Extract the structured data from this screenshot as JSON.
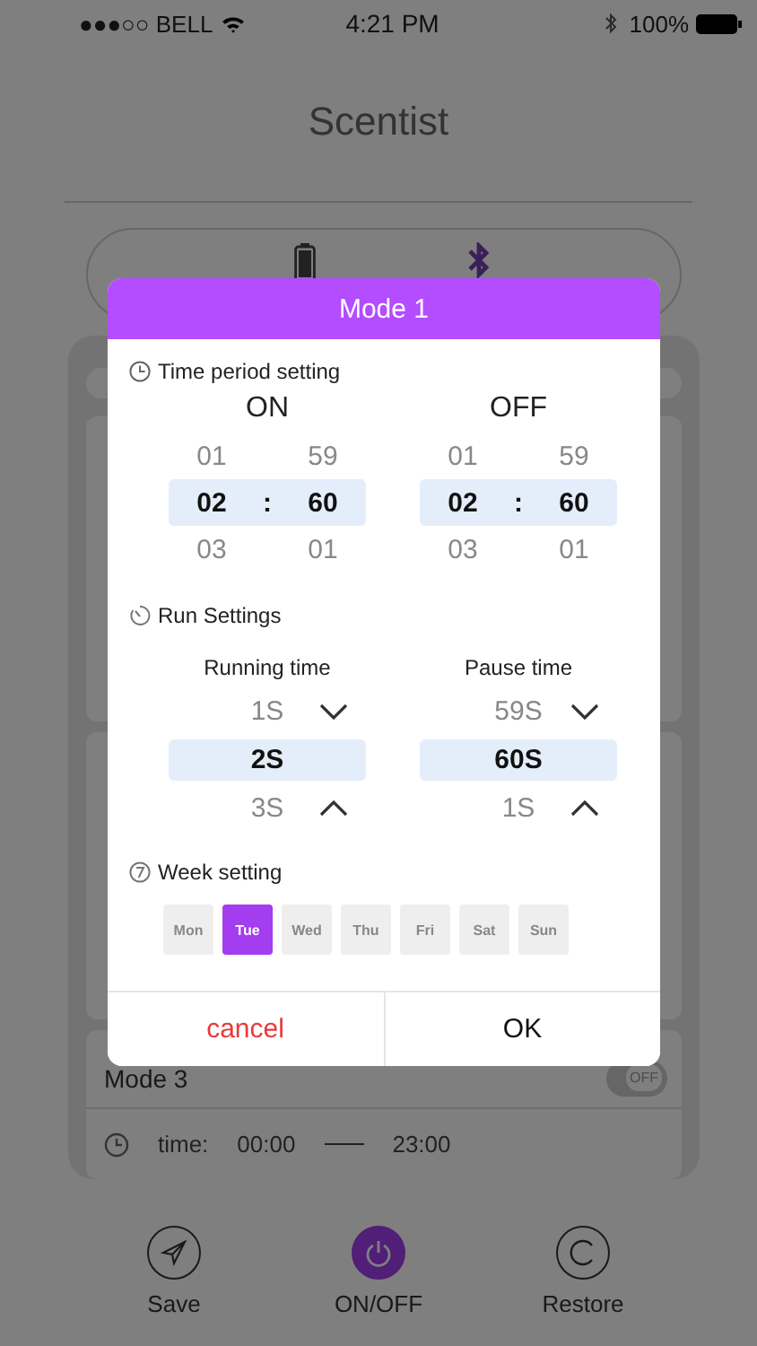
{
  "status_bar": {
    "carrier": "●●●○○ BELL",
    "time": "4:21 PM",
    "battery": "100%"
  },
  "app_title": "Scentist",
  "mode_behind": {
    "name": "Mode 3",
    "on": false,
    "toggle_label": "OFF",
    "time_label": "time:",
    "start": "00:00",
    "end": "23:00"
  },
  "dialog": {
    "title": "Mode 1",
    "time_period": {
      "heading": "Time period setting",
      "separator": ":",
      "columns": [
        {
          "label": "ON",
          "hours": [
            "01",
            "02",
            "03"
          ],
          "minutes": [
            "59",
            "60",
            "01"
          ]
        },
        {
          "label": "OFF",
          "hours": [
            "01",
            "02",
            "03"
          ],
          "minutes": [
            "59",
            "60",
            "01"
          ]
        }
      ]
    },
    "run_settings": {
      "heading": "Run Settings",
      "columns": [
        {
          "label": "Running time",
          "values": [
            "1S",
            "2S",
            "3S"
          ]
        },
        {
          "label": "Pause time",
          "values": [
            "59S",
            "60S",
            "1S"
          ]
        }
      ]
    },
    "week": {
      "heading": "Week setting",
      "days": [
        {
          "label": "Mon",
          "selected": false
        },
        {
          "label": "Tue",
          "selected": true
        },
        {
          "label": "Wed",
          "selected": false
        },
        {
          "label": "Thu",
          "selected": false
        },
        {
          "label": "Fri",
          "selected": false
        },
        {
          "label": "Sat",
          "selected": false
        },
        {
          "label": "Sun",
          "selected": false
        }
      ]
    },
    "buttons": [
      {
        "label": "cancel",
        "kind": "cancel"
      },
      {
        "label": "OK",
        "kind": "ok"
      }
    ]
  },
  "bottom_bar": [
    {
      "label": "Save",
      "kind": "send",
      "active": false
    },
    {
      "label": "ON/OFF",
      "kind": "power",
      "active": true
    },
    {
      "label": "Restore",
      "kind": "restore",
      "active": false
    }
  ]
}
